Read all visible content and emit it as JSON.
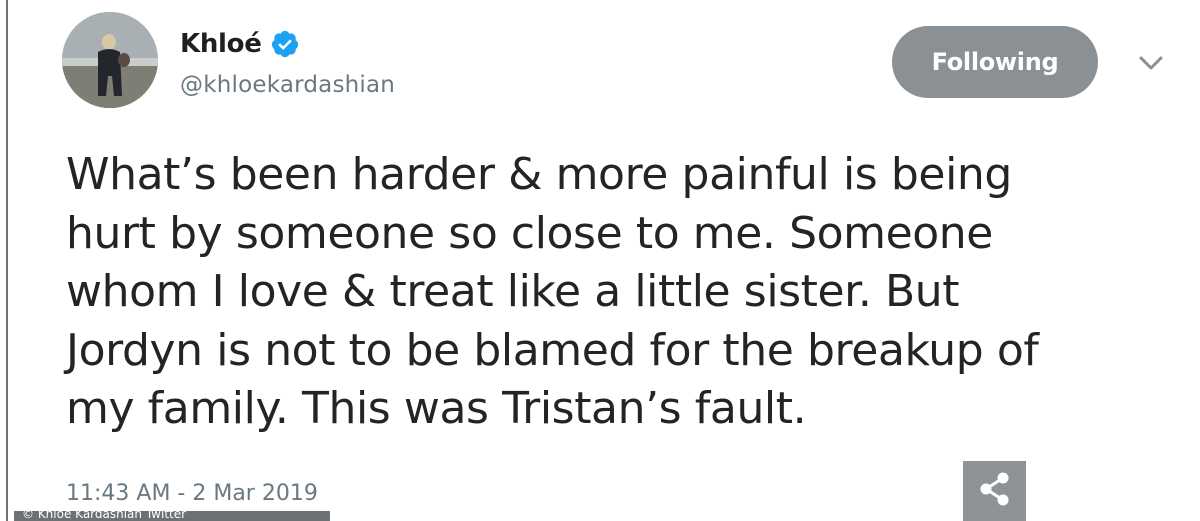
{
  "tweet": {
    "author": {
      "display_name": "Khloé",
      "handle": "@khloekardashian",
      "verified_icon": "verified-badge-icon",
      "avatar_icon": "avatar-photo"
    },
    "follow_button_label": "Following",
    "menu_icon": "chevron-down-icon",
    "text": "What’s been harder & more painful is being\nhurt by someone so close to me. Someone\nwhom I love & treat like a little sister. But\nJordyn is not to be blamed for the breakup of\nmy family. This was Tristan’s fault.",
    "timestamp": "11:43 AM - 2 Mar 2019",
    "share_icon": "share-icon"
  },
  "caption": {
    "text": "© Khloe Kardashian Twitter"
  },
  "colors": {
    "verified_blue": "#1da1f2",
    "follow_button_bg": "#8b9095",
    "text_primary": "#222426",
    "text_secondary": "#697882"
  }
}
